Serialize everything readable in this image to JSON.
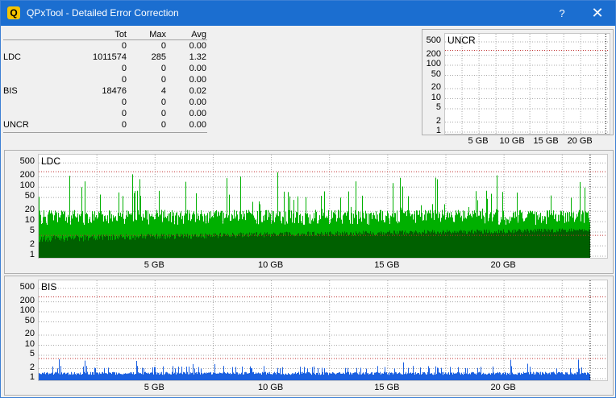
{
  "window": {
    "title": "QPxTool - Detailed Error Correction",
    "app_icon": "Q",
    "help_label": "?",
    "close_label": "✕"
  },
  "stats": {
    "headers": [
      "",
      "Tot",
      "Max",
      "Avg"
    ],
    "rows": [
      {
        "label": "",
        "tot": "0",
        "max": "0",
        "avg": "0.00"
      },
      {
        "label": "LDC",
        "tot": "1011574",
        "max": "285",
        "avg": "1.32"
      },
      {
        "label": "",
        "tot": "0",
        "max": "0",
        "avg": "0.00"
      },
      {
        "label": "",
        "tot": "0",
        "max": "0",
        "avg": "0.00"
      },
      {
        "label": "BIS",
        "tot": "18476",
        "max": "4",
        "avg": "0.02"
      },
      {
        "label": "",
        "tot": "0",
        "max": "0",
        "avg": "0.00"
      },
      {
        "label": "",
        "tot": "0",
        "max": "0",
        "avg": "0.00"
      },
      {
        "label": "UNCR",
        "tot": "0",
        "max": "0",
        "avg": "0.00"
      }
    ]
  },
  "chart_data": [
    {
      "type": "bar",
      "title": "UNCR",
      "y_scale": "log",
      "y_ticks": [
        "500",
        "200",
        "100",
        "50",
        "20",
        "10",
        "5",
        "2",
        "1"
      ],
      "x_ticks": [
        "5 GB",
        "10 GB",
        "15 GB",
        "20 GB"
      ],
      "x_range_gb": [
        0,
        24.5
      ],
      "data_end_gb": 23.7,
      "values_description": "all zero",
      "grid": true
    },
    {
      "type": "bar",
      "title": "LDC",
      "y_scale": "log",
      "y_ticks": [
        "500",
        "200",
        "100",
        "50",
        "20",
        "10",
        "5",
        "2",
        "1"
      ],
      "x_ticks": [
        "5 GB",
        "10 GB",
        "15 GB",
        "20 GB"
      ],
      "x_range_gb": [
        0,
        24.5
      ],
      "data_end_gb": 23.7,
      "max": 285,
      "avg": 1.32,
      "threshold_lines": [
        280,
        4
      ],
      "color": "#00b000",
      "dark_color": "#006000",
      "grid": true
    },
    {
      "type": "bar",
      "title": "BIS",
      "y_scale": "log",
      "y_ticks": [
        "500",
        "200",
        "100",
        "50",
        "20",
        "10",
        "5",
        "2",
        "1"
      ],
      "x_ticks": [
        "5 GB",
        "10 GB",
        "15 GB",
        "20 GB"
      ],
      "x_range_gb": [
        0,
        24.5
      ],
      "data_end_gb": 23.7,
      "max": 4,
      "avg": 0.02,
      "threshold_lines": [
        280,
        4
      ],
      "color": "#1a5fe0",
      "grid": true
    }
  ]
}
